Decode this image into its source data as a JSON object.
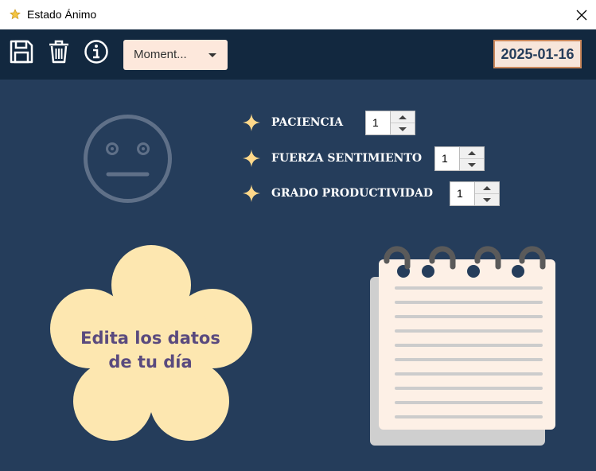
{
  "window": {
    "title": "Estado Ánimo"
  },
  "toolbar": {
    "dropdown_value": "Moment...",
    "date": "2025-01-16"
  },
  "metrics": [
    {
      "label": "PACIENCIA",
      "value": "1"
    },
    {
      "label": "FUERZA SENTIMIENTO",
      "value": "1"
    },
    {
      "label": "GRADO PRODUCTIVIDAD",
      "value": "1"
    }
  ],
  "flower": {
    "line1": "Edita los datos",
    "line2": "de tu día"
  },
  "colors": {
    "background": "#253d5b",
    "toolbar": "#12283f",
    "accent": "#ffd88a",
    "flower": "#fde7b0",
    "text_purple": "#5a4a7e"
  }
}
